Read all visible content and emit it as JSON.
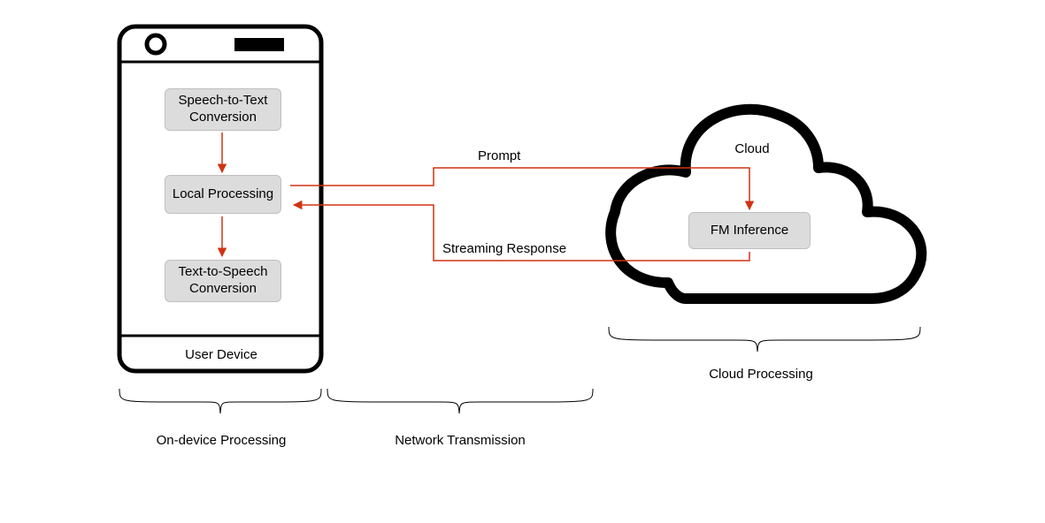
{
  "device": {
    "nodes": {
      "stt": "Speech-to-Text\nConversion",
      "local": "Local Processing",
      "tts": "Text-to-Speech\nConversion"
    },
    "label": "User Device"
  },
  "cloud": {
    "title": "Cloud",
    "inference": "FM Inference"
  },
  "arrows": {
    "prompt": "Prompt",
    "response": "Streaming Response"
  },
  "braces": {
    "ondevice": "On-device Processing",
    "network": "Network Transmission",
    "cloud": "Cloud Processing"
  }
}
